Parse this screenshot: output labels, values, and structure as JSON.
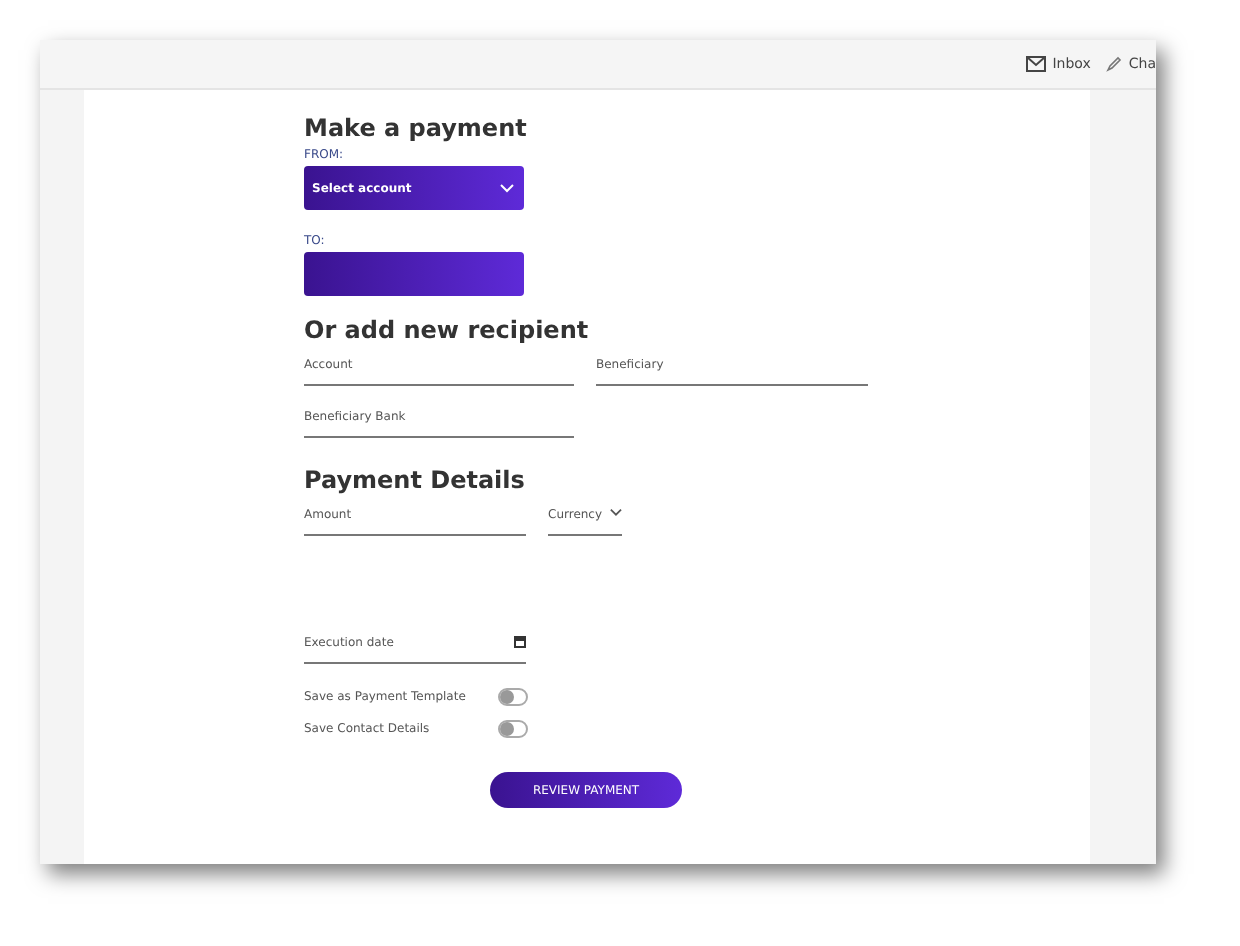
{
  "header": {
    "links": [
      {
        "label": "Inbox",
        "kind": "mail"
      },
      {
        "label": "Cha",
        "kind": "edit"
      }
    ]
  },
  "title": "Make a payment",
  "from": {
    "label": "FROM:",
    "placeholder": "Select account"
  },
  "to": {
    "label": "TO:"
  },
  "recipient": {
    "title": "Or add new recipient",
    "fields": [
      {
        "placeholder": "Account"
      },
      {
        "placeholder": "Beneficiary"
      },
      {
        "placeholder": "Beneficiary Bank"
      }
    ]
  },
  "details": {
    "title": "Payment Details",
    "amount": {
      "placeholder": "Amount"
    },
    "currency": {
      "placeholder": "Currency"
    },
    "execution_date": {
      "placeholder": "Execution date"
    }
  },
  "toggles": [
    {
      "label": "Save as Payment Template",
      "on": false
    },
    {
      "label": "Save Contact Details",
      "on": false
    }
  ],
  "button": "REVIEW PAYMENT"
}
